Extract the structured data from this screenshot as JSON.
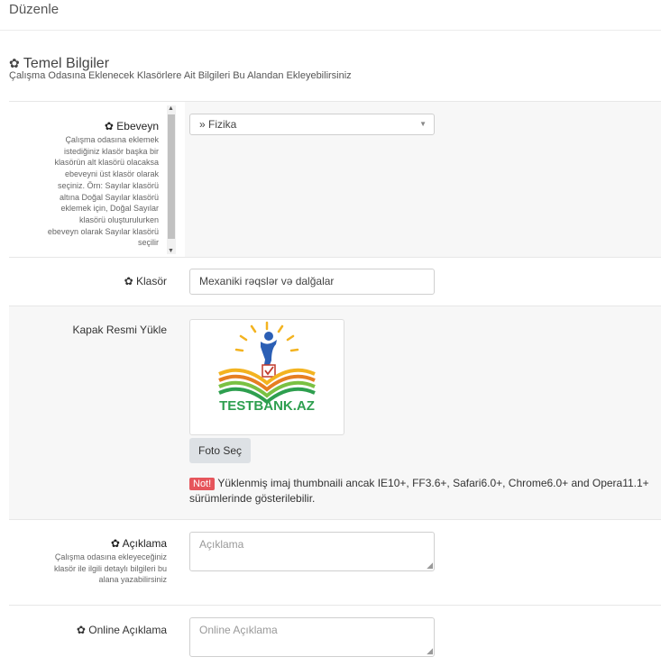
{
  "page": {
    "title": "Düzenle"
  },
  "section": {
    "title": "Temel Bilgiler",
    "subtitle": "Çalışma Odasına Eklenecek Klasörlere Ait Bilgileri Bu Alandan Ekleyebilirsiniz"
  },
  "ebeveyn": {
    "label": "Ebeveyn",
    "hint_lines": [
      "Çalışma odasına eklemek",
      "istediğiniz klasör başka bir",
      "klasörün alt klasörü olacaksa",
      "ebeveyni üst klasör olarak",
      "seçiniz. Örn: Sayılar klasörü",
      "altına Doğal Sayılar klasörü",
      "eklemek için, Doğal Sayılar",
      "klasörü oluşturulurken",
      "ebeveyn olarak Sayılar klasörü",
      "seçilir"
    ],
    "selected": "» Fizika"
  },
  "klasor": {
    "label": "Klasör",
    "value": "Mexaniki rəqslər və dalğalar"
  },
  "kapak": {
    "label": "Kapak Resmi Yükle",
    "logo_text": "TESTBANK.AZ",
    "button": "Foto Seç",
    "badge": "Not!",
    "note": "Yüklenmiş imaj thumbnaili ancak IE10+, FF3.6+, Safari6.0+, Chrome6.0+ and Opera11.1+ sürümlerinde gösterilebilir."
  },
  "aciklama": {
    "label": "Açıklama",
    "hint_lines": [
      "Çalışma odasına ekleyeceğiniz",
      "klasör ile ilgili detaylı bilgileri bu",
      "alana yazabilirsiniz"
    ],
    "placeholder": "Açıklama"
  },
  "online": {
    "label": "Online Açıklama",
    "placeholder": "Online Açıklama"
  }
}
